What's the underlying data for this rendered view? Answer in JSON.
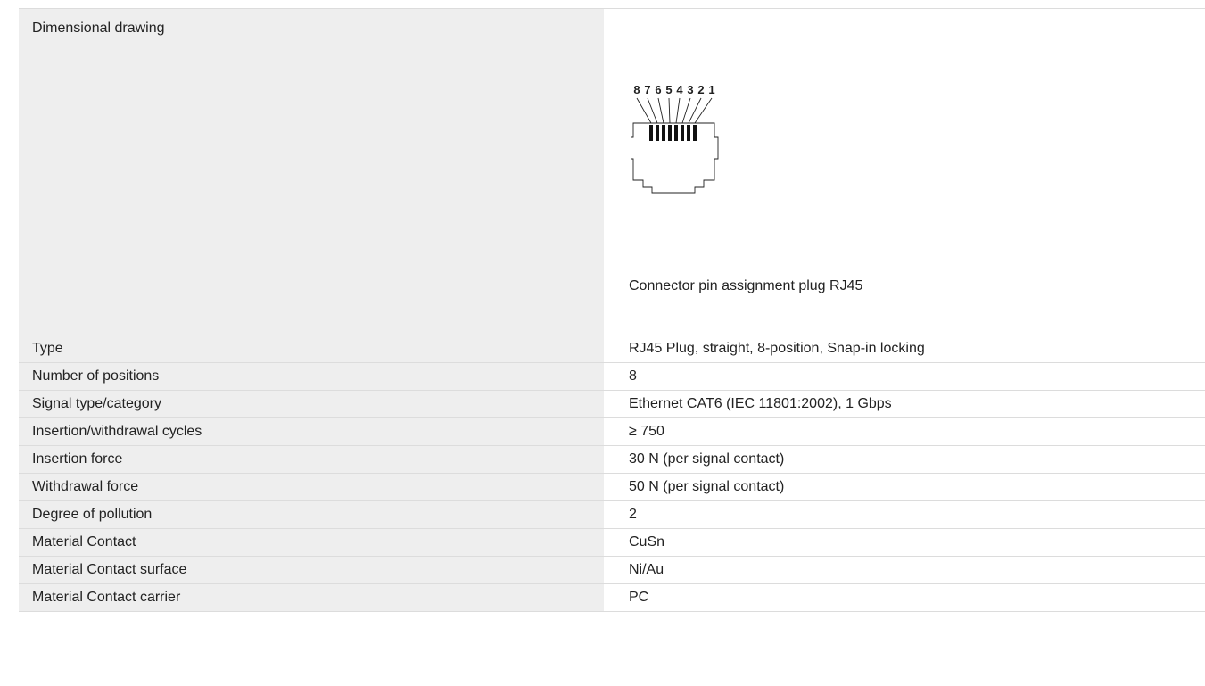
{
  "drawing_row": {
    "label": "Dimensional drawing",
    "pin_numbers": [
      "8",
      "7",
      "6",
      "5",
      "4",
      "3",
      "2",
      "1"
    ],
    "caption": "Connector pin assignment plug RJ45"
  },
  "spec_rows": [
    {
      "label": "Type",
      "value": "RJ45 Plug, straight, 8-position, Snap-in locking"
    },
    {
      "label": "Number of positions",
      "value": "8"
    },
    {
      "label": "Signal type/category",
      "value": "Ethernet CAT6 (IEC 11801:2002), 1 Gbps"
    },
    {
      "label": "Insertion/withdrawal cycles",
      "value": "≥ 750"
    },
    {
      "label": "Insertion force",
      "value": "30 N (per signal contact)"
    },
    {
      "label": "Withdrawal force",
      "value": "50 N (per signal contact)"
    },
    {
      "label": "Degree of pollution",
      "value": "2"
    },
    {
      "label": "Material Contact",
      "value": "CuSn"
    },
    {
      "label": "Material Contact surface",
      "value": "Ni/Au"
    },
    {
      "label": "Material Contact carrier",
      "value": "PC"
    }
  ]
}
